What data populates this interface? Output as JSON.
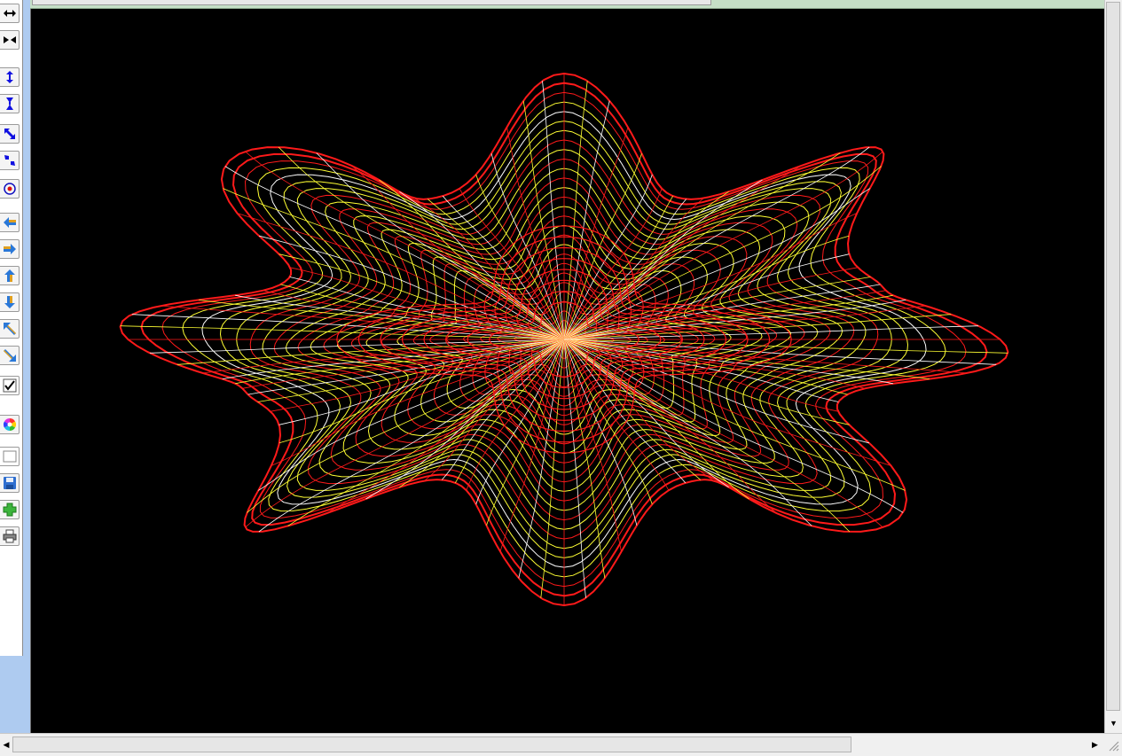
{
  "toolbar": {
    "buttons": [
      {
        "name": "stretch-horizontal-icon",
        "glyph": "↔"
      },
      {
        "name": "shrink-horizontal-icon",
        "glyph": "⇹"
      },
      {
        "name": "stretch-vertical-icon",
        "glyph": "↕"
      },
      {
        "name": "shrink-vertical-icon",
        "glyph": "⇳"
      },
      {
        "name": "stretch-diagonal-icon",
        "glyph": "⤡"
      },
      {
        "name": "shrink-diagonal-icon",
        "glyph": "⤢"
      },
      {
        "name": "center-target-icon",
        "glyph": "◎"
      },
      {
        "name": "move-left-icon",
        "glyph": "⇦"
      },
      {
        "name": "move-right-icon",
        "glyph": "⇨"
      },
      {
        "name": "move-up-icon",
        "glyph": "⇧"
      },
      {
        "name": "move-down-icon",
        "glyph": "⇩"
      },
      {
        "name": "move-up-left-icon",
        "glyph": "⬁"
      },
      {
        "name": "move-down-right-icon",
        "glyph": "⬂"
      },
      {
        "name": "checkbox-icon",
        "glyph": "✔"
      },
      {
        "name": "color-wheel-icon",
        "glyph": "●"
      },
      {
        "name": "blank-swatch-icon",
        "glyph": ""
      },
      {
        "name": "save-icon",
        "glyph": "💾"
      },
      {
        "name": "add-icon",
        "glyph": "✚"
      },
      {
        "name": "print-icon",
        "glyph": "⎙"
      }
    ],
    "checkbox_checked": true
  },
  "scrollbars": {
    "vertical_down_glyph": "▼",
    "horizontal_left_glyph": "◀",
    "horizontal_right_glyph": "▶"
  },
  "canvas": {
    "background": "#000000",
    "mesh_colors": [
      "#ff1a1a",
      "#ffff33",
      "#ffffff"
    ]
  }
}
